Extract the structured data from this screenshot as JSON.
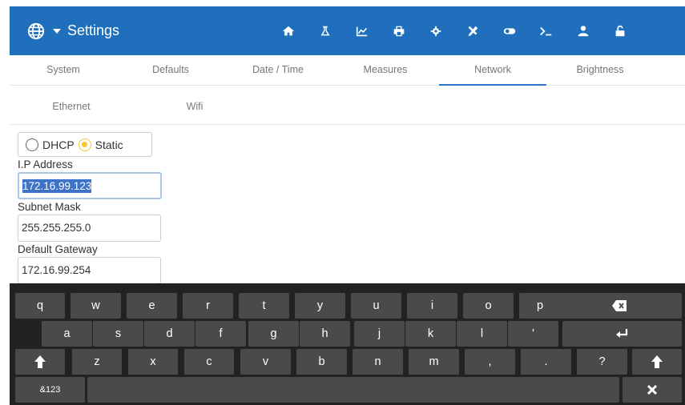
{
  "header": {
    "title": "Settings",
    "icons": [
      "home-icon",
      "flask-icon",
      "chart-icon",
      "printer-icon",
      "gear-icon",
      "tools-icon",
      "toggle-icon",
      "terminal-icon",
      "user-icon",
      "unlock-icon"
    ],
    "bar_color": "#1f6fbd"
  },
  "tabs": [
    {
      "label": "System",
      "active": false
    },
    {
      "label": "Defaults",
      "active": false
    },
    {
      "label": "Date / Time",
      "active": false
    },
    {
      "label": "Measures",
      "active": false
    },
    {
      "label": "Network",
      "active": true
    },
    {
      "label": "Brightness",
      "active": false
    }
  ],
  "subtabs": [
    {
      "label": "Ethernet",
      "active": true
    },
    {
      "label": "Wifi",
      "active": false
    }
  ],
  "network": {
    "mode_options": [
      "DHCP",
      "Static"
    ],
    "mode_selected": "Static",
    "ip_label": "I.P Address",
    "ip_value": "172.16.99.123",
    "subnet_label": "Subnet Mask",
    "subnet_value": "255.255.255.0",
    "gateway_label": "Default Gateway",
    "gateway_value": "172.16.99.254"
  },
  "keyboard": {
    "row1": [
      "q",
      "w",
      "e",
      "r",
      "t",
      "y",
      "u",
      "i",
      "o",
      "p"
    ],
    "row2": [
      "a",
      "s",
      "d",
      "f",
      "g",
      "h",
      "j",
      "k",
      "l",
      "'"
    ],
    "row3": [
      "z",
      "x",
      "c",
      "v",
      "b",
      "n",
      "m",
      ",",
      ".",
      "?"
    ],
    "mode_key": "&123"
  }
}
